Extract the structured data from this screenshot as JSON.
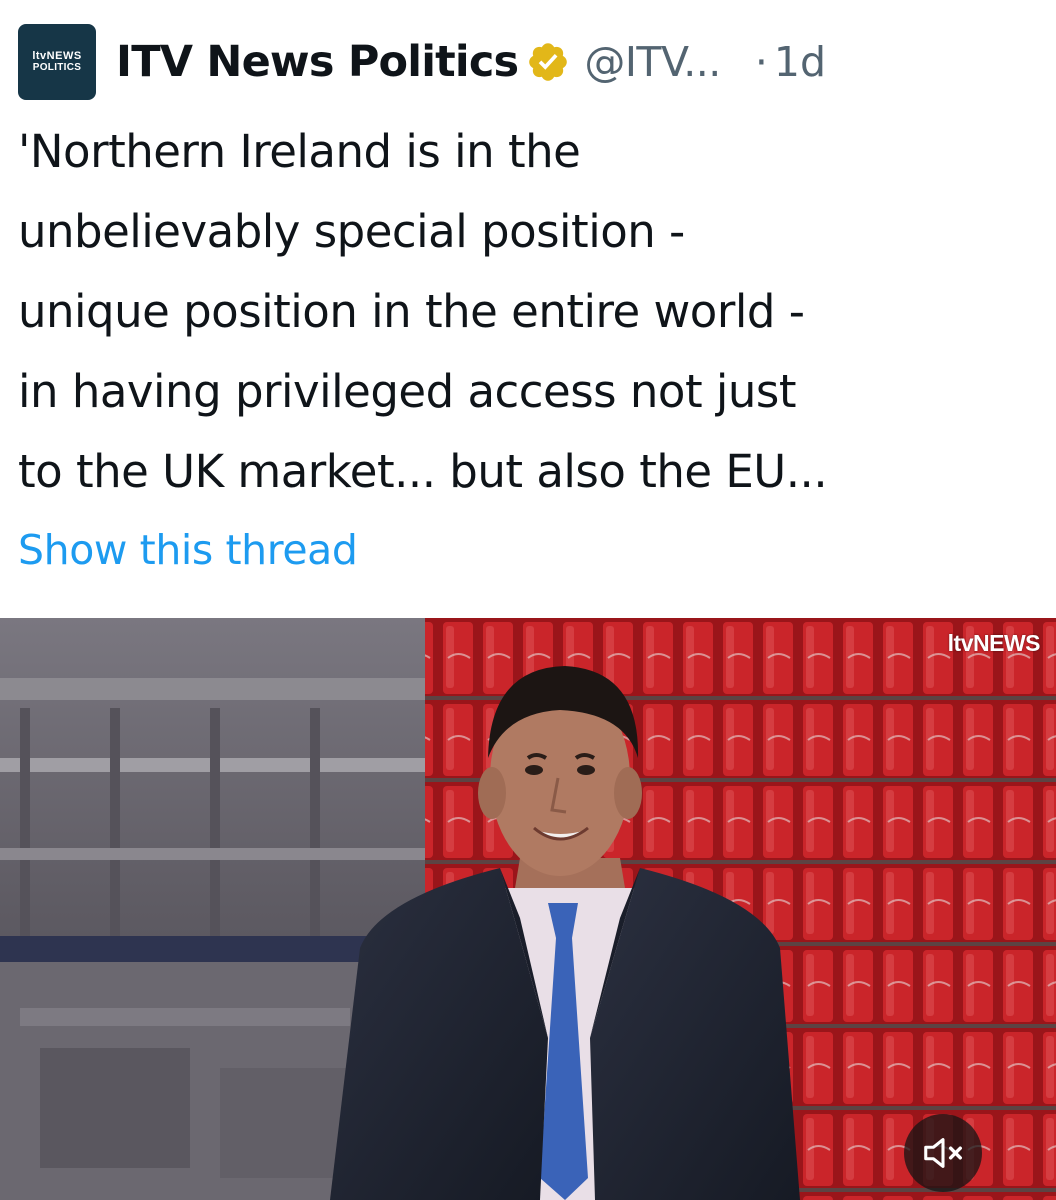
{
  "tweet": {
    "avatar": {
      "line1": "ltvNEWS",
      "line2": "POLITICS"
    },
    "display_name": "ITV News Politics",
    "verified_icon": "verified-badge-icon",
    "handle": "@ITV...",
    "separator": "·",
    "time": "1d",
    "text_lines": [
      "'Northern Ireland is in the",
      "unbelievably special position -",
      "unique position in the entire world -",
      "in having privileged access not just",
      "to the UK market... but also the EU..."
    ],
    "show_thread": "Show this thread",
    "media": {
      "watermark": "ltvNEWS",
      "mute_icon": "speaker-muted-icon"
    }
  },
  "colors": {
    "text": "#0f1419",
    "secondary": "#536471",
    "link": "#1d9bf0",
    "verified_gold": "#e2b719",
    "avatar_bg": "#163647"
  }
}
